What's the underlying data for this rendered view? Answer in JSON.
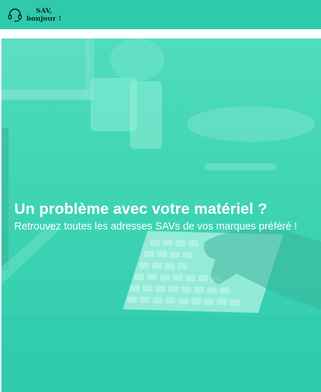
{
  "header": {
    "logo_line1": "SAV,",
    "logo_line2": "bonjour !",
    "logo_icon": "headset-icon",
    "background_color": "#2fcaab"
  },
  "hero": {
    "title": "Un problème avec votre matériel ?",
    "subtitle": "Retrouvez toutes les adresses SAVs de vos marques préféré !",
    "overlay_color": "#3ed4b4"
  }
}
